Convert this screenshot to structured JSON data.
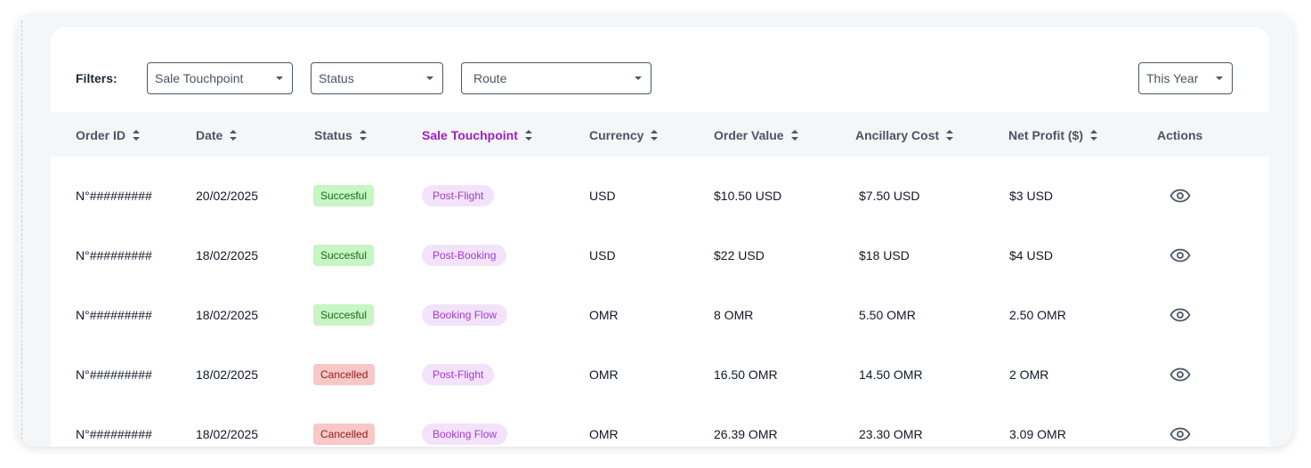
{
  "filters": {
    "label": "Filters:",
    "sale_touchpoint": "Sale Touchpoint",
    "status": "Status",
    "route": "Route",
    "period": "This Year"
  },
  "table": {
    "headers": {
      "order_id": "Order ID",
      "date": "Date",
      "status": "Status",
      "sale_touchpoint": "Sale Touchpoint",
      "currency": "Currency",
      "order_value": "Order Value",
      "ancillary_cost": "Ancillary Cost",
      "net_profit": "Net Profit ($)",
      "actions": "Actions"
    },
    "rows": [
      {
        "order_id": "N°#########",
        "date": "20/02/2025",
        "status": "Succesful",
        "touchpoint": "Post-Flight",
        "currency": "USD",
        "order_value": "$10.50 USD",
        "ancillary_cost": "$7.50 USD",
        "net_profit": "$3 USD"
      },
      {
        "order_id": "N°#########",
        "date": "18/02/2025",
        "status": "Succesful",
        "touchpoint": "Post-Booking",
        "currency": "USD",
        "order_value": "$22 USD",
        "ancillary_cost": "$18 USD",
        "net_profit": "$4 USD"
      },
      {
        "order_id": "N°#########",
        "date": "18/02/2025",
        "status": "Succesful",
        "touchpoint": "Booking Flow",
        "currency": "OMR",
        "order_value": "8 OMR",
        "ancillary_cost": "5.50 OMR",
        "net_profit": "2.50 OMR"
      },
      {
        "order_id": "N°#########",
        "date": "18/02/2025",
        "status": "Cancelled",
        "touchpoint": "Post-Flight",
        "currency": "OMR",
        "order_value": "16.50 OMR",
        "ancillary_cost": "14.50 OMR",
        "net_profit": "2 OMR"
      },
      {
        "order_id": "N°#########",
        "date": "18/02/2025",
        "status": "Cancelled",
        "touchpoint": "Booking Flow",
        "currency": "OMR",
        "order_value": "26.39 OMR",
        "ancillary_cost": "23.30 OMR",
        "net_profit": "3.09 OMR"
      }
    ]
  },
  "icons": {
    "view": "eye-icon",
    "sort": "sort-icon",
    "dropdown": "chevron-down-icon"
  },
  "colors": {
    "accent": "#9b1fc7",
    "success_bg": "#c7f5c4",
    "cancel_bg": "#f8c7c7",
    "pill_bg": "#f3e3fa"
  }
}
